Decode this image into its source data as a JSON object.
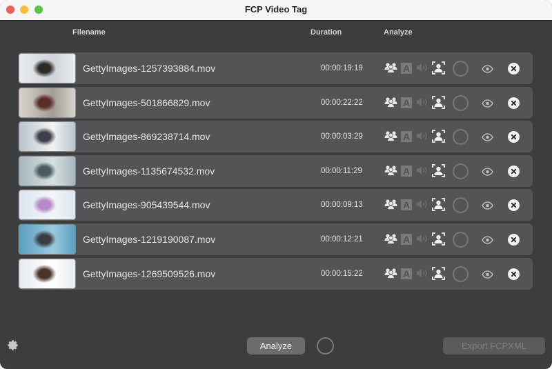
{
  "window": {
    "title": "FCP Video Tag"
  },
  "columns": {
    "filename": "Filename",
    "duration": "Duration",
    "analyze": "Analyze"
  },
  "icons": {
    "people": "people-group-icon",
    "text": "text-detection-icon",
    "audio": "speaker-icon",
    "face": "face-detection-icon",
    "progress": "progress-ring-icon",
    "preview": "eye-icon",
    "remove": "close-circle-icon",
    "settings": "gear-icon"
  },
  "analyze_features": {
    "text_glyph": "A"
  },
  "files": [
    {
      "filename": "GettyImages-1257393884.mov",
      "duration": "00:00:19:19",
      "thumb_colors": [
        "#e9ecee",
        "#cfd4d8",
        "#2e2a28"
      ]
    },
    {
      "filename": "GettyImages-501866829.mov",
      "duration": "00:00:22:22",
      "thumb_colors": [
        "#d8d4cf",
        "#a29c95",
        "#5a2d2a"
      ]
    },
    {
      "filename": "GettyImages-869238714.mov",
      "duration": "00:00:03:29",
      "thumb_colors": [
        "#b9c4cc",
        "#f2f2f2",
        "#3e3f4a"
      ]
    },
    {
      "filename": "GettyImages-1135674532.mov",
      "duration": "00:00:11:29",
      "thumb_colors": [
        "#a7b7be",
        "#d6e0e2",
        "#4b5b60"
      ]
    },
    {
      "filename": "GettyImages-905439544.mov",
      "duration": "00:00:09:13",
      "thumb_colors": [
        "#dbe6f0",
        "#f3f5f7",
        "#b68ac7"
      ]
    },
    {
      "filename": "GettyImages-1219190087.mov",
      "duration": "00:00:12:21",
      "thumb_colors": [
        "#5b9dbf",
        "#9ccae0",
        "#3a3c40"
      ]
    },
    {
      "filename": "GettyImages-1269509526.mov",
      "duration": "00:00:15:22",
      "thumb_colors": [
        "#e8ecef",
        "#ffffff",
        "#4a3426"
      ]
    }
  ],
  "footer": {
    "analyze_label": "Analyze",
    "export_label": "Export FCPXML"
  },
  "colors": {
    "window_bg": "#3c3d3f",
    "row_bg": "#545456",
    "titlebar_bg": "#f6f6f6",
    "close": "#ee5f58",
    "minimize": "#f8bd3a",
    "maximize": "#58c443"
  }
}
